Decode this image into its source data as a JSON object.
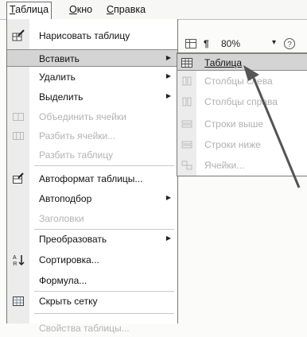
{
  "menubar": {
    "items": [
      {
        "label": "Таблица"
      },
      {
        "label": "Окно"
      },
      {
        "label": "Справка"
      }
    ]
  },
  "toolbar": {
    "pilcrow": "¶",
    "zoom": "80%",
    "dropdown": "▾"
  },
  "table_menu": {
    "items": [
      {
        "label": "Нарисовать таблицу",
        "icon": "pencil-icon",
        "state": "enabled"
      },
      {
        "label": "Вставить",
        "state": "highlighted",
        "submenu": true
      },
      {
        "label": "Удалить",
        "state": "enabled",
        "submenu": true
      },
      {
        "label": "Выделить",
        "state": "enabled",
        "submenu": true
      },
      {
        "label": "Объединить ячейки",
        "icon": "merge-cells-icon",
        "state": "disabled"
      },
      {
        "label": "Разбить ячейки...",
        "icon": "split-cells-icon",
        "state": "disabled"
      },
      {
        "label": "Разбить таблицу",
        "state": "disabled"
      },
      {
        "label": "Автоформат таблицы...",
        "icon": "autoformat-icon",
        "state": "enabled"
      },
      {
        "label": "Автоподбор",
        "state": "enabled",
        "submenu": true
      },
      {
        "label": "Заголовки",
        "state": "disabled"
      },
      {
        "label": "Преобразовать",
        "state": "enabled",
        "submenu": true
      },
      {
        "label": "Сортировка...",
        "icon": "sort-az-icon",
        "state": "enabled"
      },
      {
        "label": "Формула...",
        "state": "enabled"
      },
      {
        "label": "Скрыть сетку",
        "icon": "grid-icon",
        "state": "enabled"
      },
      {
        "label": "Свойства таблицы...",
        "state": "disabled"
      }
    ]
  },
  "insert_submenu": {
    "items": [
      {
        "label": "Таблица",
        "icon": "table-icon",
        "state": "highlighted"
      },
      {
        "label": "Столбцы слева",
        "icon": "columns-left-icon",
        "state": "disabled"
      },
      {
        "label": "Столбцы справа",
        "icon": "columns-right-icon",
        "state": "disabled"
      },
      {
        "label": "Строки выше",
        "icon": "rows-above-icon",
        "state": "disabled"
      },
      {
        "label": "Строки ниже",
        "icon": "rows-below-icon",
        "state": "disabled"
      },
      {
        "label": "Ячейки...",
        "icon": "cells-icon",
        "state": "disabled"
      }
    ]
  }
}
